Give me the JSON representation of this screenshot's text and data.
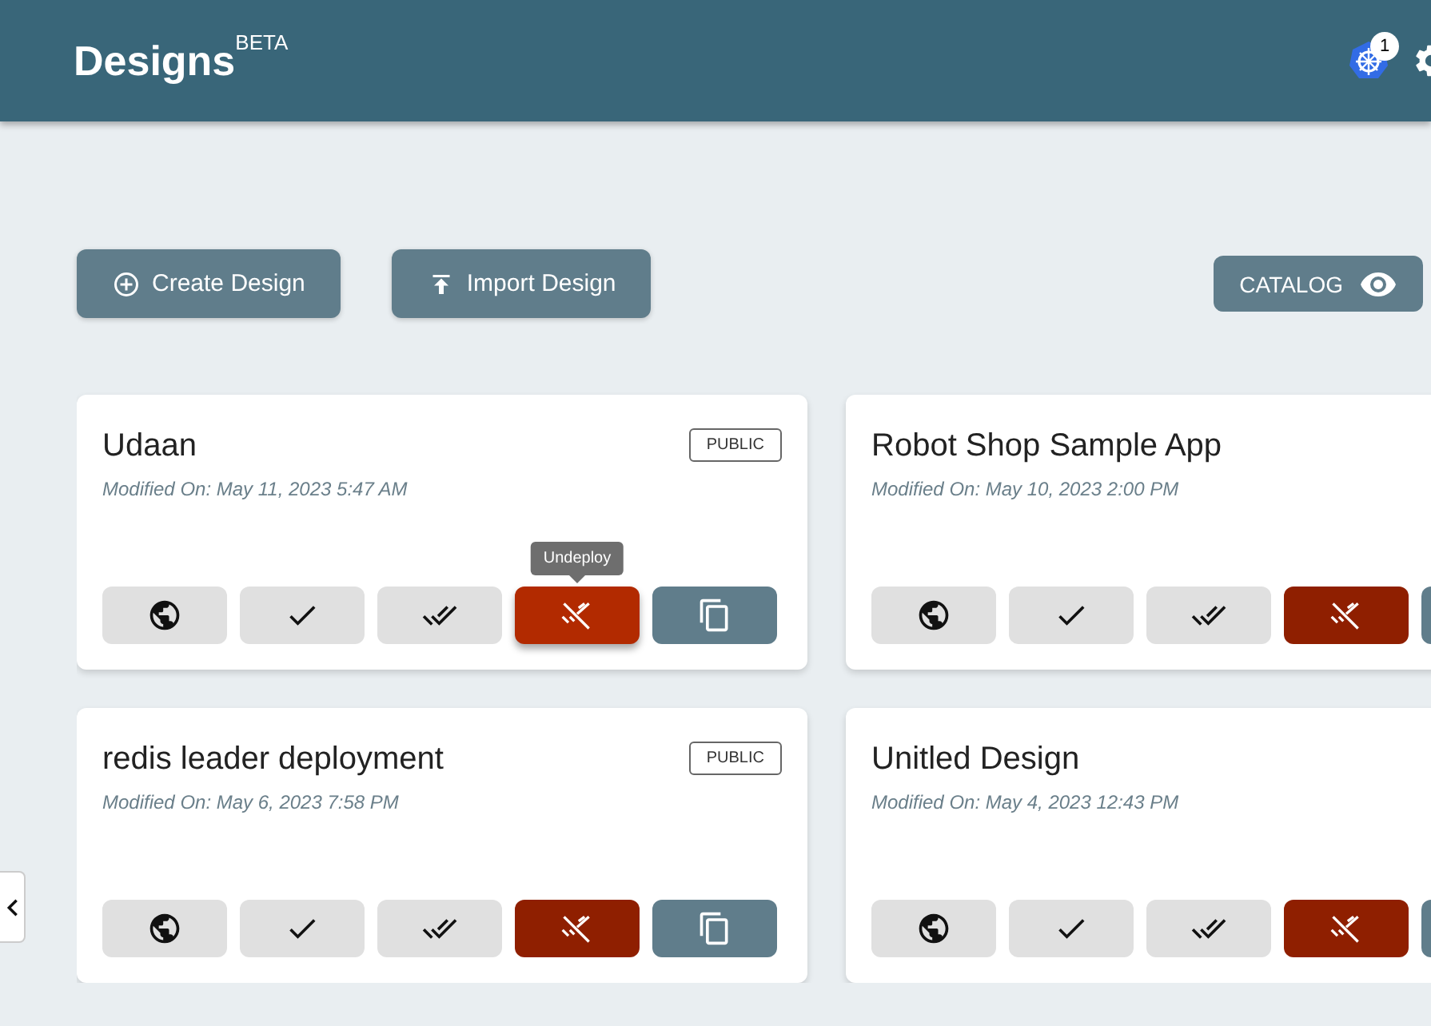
{
  "header": {
    "title": "Designs",
    "superscript": "BETA",
    "notification_count": "1"
  },
  "toolbar": {
    "buttons": [
      {
        "kind": "create",
        "label": "Create Design"
      },
      {
        "kind": "import",
        "label": "Import Design"
      }
    ],
    "catalog": {
      "label": "CATALOG"
    }
  },
  "cards": [
    {
      "name": "Udaan",
      "visibility": "PUBLIC",
      "modified": "Modified On: May 11, 2023 5:47 AM",
      "actions": [
        {
          "kind": "publish",
          "hovered": false
        },
        {
          "kind": "validate",
          "hovered": false
        },
        {
          "kind": "deploy",
          "hovered": false
        },
        {
          "kind": "undeploy",
          "hovered": true,
          "tooltip": "Undeploy"
        },
        {
          "kind": "clone",
          "hovered": false
        }
      ]
    },
    {
      "name": "Robot Shop Sample App",
      "modified": "Modified On: May 10, 2023 2:00 PM",
      "actions": [
        {
          "kind": "publish",
          "hovered": false
        },
        {
          "kind": "validate",
          "hovered": false
        },
        {
          "kind": "deploy",
          "hovered": false
        },
        {
          "kind": "undeploy",
          "hovered": false
        },
        {
          "kind": "clone",
          "hovered": false
        }
      ]
    },
    {
      "name": "redis leader deployment",
      "visibility": "PUBLIC",
      "modified": "Modified On: May 6, 2023 7:58 PM",
      "actions": [
        {
          "kind": "publish",
          "hovered": false
        },
        {
          "kind": "validate",
          "hovered": false
        },
        {
          "kind": "deploy",
          "hovered": false
        },
        {
          "kind": "undeploy",
          "hovered": false
        },
        {
          "kind": "clone",
          "hovered": false
        }
      ]
    },
    {
      "name": "Unitled Design",
      "modified": "Modified On: May 4, 2023 12:43 PM",
      "actions": [
        {
          "kind": "publish",
          "hovered": false
        },
        {
          "kind": "validate",
          "hovered": false
        },
        {
          "kind": "deploy",
          "hovered": false
        },
        {
          "kind": "undeploy",
          "hovered": false
        },
        {
          "kind": "clone",
          "hovered": false
        }
      ]
    }
  ]
}
